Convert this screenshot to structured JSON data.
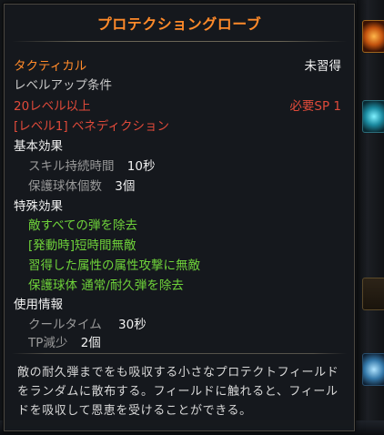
{
  "tooltip": {
    "title": "プロテクショングローブ",
    "category": "タクティカル",
    "learn_status": "未習得",
    "levelup_condition_label": "レベルアップ条件",
    "level_requirement": "20レベル以上",
    "sp_requirement": "必要SP 1",
    "prerequisite_skill": "[レベル1] ベネディクション",
    "basic_effects": {
      "header": "基本効果",
      "items": [
        {
          "label": "スキル持続時間",
          "value": "10秒"
        },
        {
          "label": "保護球体個数",
          "value": "3個"
        }
      ]
    },
    "special_effects": {
      "header": "特殊効果",
      "items": [
        "敵すべての弾を除去",
        "[発動時]短時間無敵",
        "習得した属性の属性攻撃に無敵",
        "保護球体 通常/耐久弾を除去"
      ]
    },
    "usage_info": {
      "header": "使用情報",
      "items": [
        {
          "label": "クールタイム",
          "value": "30秒"
        },
        {
          "label": "TP減少",
          "value": "2個"
        }
      ]
    },
    "description": "敵の耐久弾までをも吸収する小さなプロテクトフィールドをランダムに散布する。フィールドに触れると、フィールドを吸収して恩恵を受けることができる。"
  },
  "colors": {
    "title": "#ff8a2a",
    "requirement_unmet": "#e04a3a",
    "special_effect": "#6fd33a"
  }
}
